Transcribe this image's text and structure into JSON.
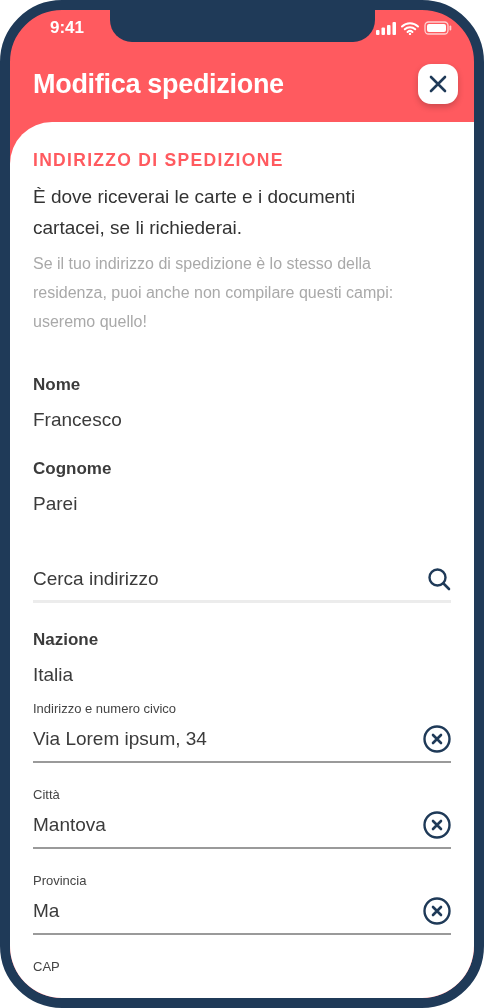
{
  "status_bar": {
    "time": "9:41"
  },
  "header": {
    "title": "Modifica spedizione"
  },
  "section": {
    "heading": "INDIRIZZO DI SPEDIZIONE",
    "intro": "È dove riceverai le carte e i documenti cartacei, se li richiederai.",
    "note": "Se il tuo indirizzo di spedizione è lo stesso della residenza, puoi anche non compilare questi campi: useremo quello!"
  },
  "info_fields": [
    {
      "label": "Nome",
      "value": "Francesco"
    },
    {
      "label": "Cognome",
      "value": "Parei"
    }
  ],
  "search": {
    "placeholder": "Cerca indirizzo"
  },
  "country": {
    "label": "Nazione",
    "value": "Italia"
  },
  "address_fields": [
    {
      "label": "Indirizzo e numero civico",
      "value": "Via Lorem ipsum, 34"
    },
    {
      "label": "Città",
      "value": "Mantova"
    },
    {
      "label": "Provincia",
      "value": "Ma"
    },
    {
      "label": "CAP"
    }
  ]
}
